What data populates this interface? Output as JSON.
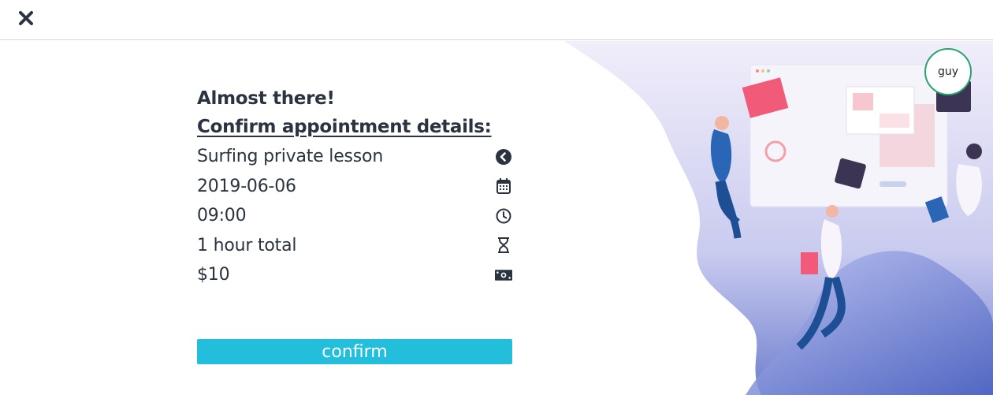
{
  "header": {
    "close_icon": "close-icon"
  },
  "user": {
    "avatar_label": "guy"
  },
  "confirmation": {
    "heading": "Almost there!",
    "subheading": "Confirm appointment details:",
    "details": [
      {
        "label": "Surfing private lesson",
        "icon": "back-circle-icon"
      },
      {
        "label": "2019-06-06",
        "icon": "calendar-icon"
      },
      {
        "label": "09:00",
        "icon": "clock-icon"
      },
      {
        "label": "1 hour total",
        "icon": "hourglass-icon"
      },
      {
        "label": "$10",
        "icon": "money-icon"
      }
    ],
    "confirm_label": "confirm"
  },
  "colors": {
    "text": "#2b3340",
    "accent": "#22bedc",
    "avatar_border": "#27a36f",
    "divider": "#d4d6d9"
  }
}
